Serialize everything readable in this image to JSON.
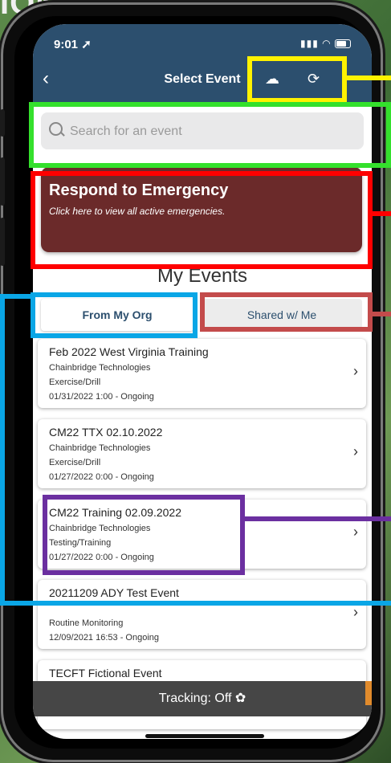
{
  "background": {
    "title_fragment": "ION"
  },
  "status_bar": {
    "time": "9:01 ➚",
    "signal": "▮▮▮",
    "wifi": "◠"
  },
  "header": {
    "back_label": "‹",
    "title": "Select Event",
    "download_icon": "☁",
    "refresh_icon": "⟳"
  },
  "search": {
    "placeholder": "Search for an event",
    "value": ""
  },
  "emergency": {
    "title": "Respond to Emergency",
    "subtitle": "Click here to view all active emergencies."
  },
  "events_section": {
    "title": "My Events",
    "tabs": [
      {
        "label": "From My Org",
        "active": true
      },
      {
        "label": "Shared w/ Me",
        "active": false
      }
    ],
    "items": [
      {
        "name": "Feb 2022 West Virginia Training",
        "org": "Chainbridge Technologies",
        "type": "Exercise/Drill",
        "date": "01/31/2022 1:00 - Ongoing"
      },
      {
        "name": "CM22 TTX 02.10.2022",
        "org": "Chainbridge Technologies",
        "type": "Exercise/Drill",
        "date": "01/27/2022 0:00 - Ongoing"
      },
      {
        "name": "CM22 Training 02.09.2022",
        "org": "Chainbridge Technologies",
        "type": "Testing/Training",
        "date": "01/27/2022 0:00 - Ongoing"
      },
      {
        "name": "20211209 ADY Test Event",
        "org": "",
        "type": "Routine Monitoring",
        "date": "12/09/2021 16:53 - Ongoing"
      },
      {
        "name": "TECFT Fictional Event",
        "org": "",
        "type": "",
        "date": ""
      }
    ],
    "chevron": "›"
  },
  "tracking": {
    "label": "Tracking:",
    "value": "Off",
    "gear_icon": "✿"
  },
  "colors": {
    "header_bg": "#2c4f6e",
    "emergency_bg": "#6b2a2a",
    "tracking_bg": "#464646",
    "annotation_yellow": "#fff200",
    "annotation_green": "#34e02c",
    "annotation_red": "#ff0000",
    "annotation_blue": "#0aa6e6",
    "annotation_rose": "#c34b4b",
    "annotation_purple": "#6b2fa0"
  }
}
